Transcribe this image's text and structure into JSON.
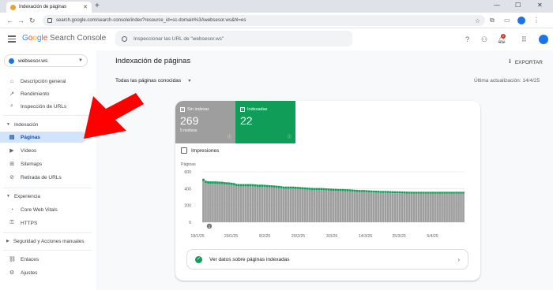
{
  "browser": {
    "tab_title": "Indexación de páginas",
    "new_tab": "+",
    "url": "search.google.com/search-console/index?resource_id=sc-domain%3Awebsesor.ws&hl=es",
    "minimize": "—",
    "maximize": "☐",
    "close": "✕"
  },
  "header": {
    "logo_google": [
      "G",
      "o",
      "o",
      "g",
      "l",
      "e"
    ],
    "logo_product": " Search Console",
    "search_placeholder": "Inspeccionar las URL de \"websesor.ws\"",
    "notification_count": "2"
  },
  "sidebar": {
    "property": "websesor.ws",
    "items": [
      {
        "label": "Descripción general",
        "icon": "home-icon"
      },
      {
        "label": "Rendimiento",
        "icon": "trend-icon"
      },
      {
        "label": "Inspección de URLs",
        "icon": "search-icon"
      },
      {
        "label": "Páginas",
        "icon": "pages-icon"
      },
      {
        "label": "Vídeos",
        "icon": "video-icon"
      },
      {
        "label": "Sitemaps",
        "icon": "sitemap-icon"
      },
      {
        "label": "Retirada de URLs",
        "icon": "removal-icon"
      },
      {
        "label": "Core Web Vitals",
        "icon": "speed-icon"
      },
      {
        "label": "HTTPS",
        "icon": "lock-icon"
      },
      {
        "label": "Enlaces",
        "icon": "links-icon"
      },
      {
        "label": "Ajustes",
        "icon": "gear-icon"
      }
    ],
    "sections": [
      "Indexación",
      "Experiencia",
      "Seguridad y Acciones manuales"
    ]
  },
  "main": {
    "title": "Indexación de páginas",
    "export_label": "EXPORTAR",
    "filter_label": "Todas las páginas conocidas",
    "last_update": "Última actualización: 14/4/25",
    "not_indexed": {
      "label": "Sin indexar",
      "value": "269",
      "sub": "5 motivos"
    },
    "indexed": {
      "label": "Indexadas",
      "value": "22"
    },
    "impressions_label": "Impresiones",
    "indexed_link": "Ver datos sobre páginas indexadas"
  },
  "colors": {
    "not_indexed": "#9e9e9e",
    "indexed": "#0f9d58",
    "active_nav": "#d2e3fc",
    "arrow": "#ff0000"
  },
  "chart_data": {
    "type": "bar",
    "ylabel": "Páginas",
    "ylim": [
      0,
      600
    ],
    "yticks": [
      "600",
      "400",
      "200",
      "0"
    ],
    "xticks": [
      "18/1/25",
      "29/1/25",
      "9/2/25",
      "20/2/25",
      "3/3/25",
      "14/3/25",
      "25/3/25",
      "5/4/25"
    ],
    "annotation": "1",
    "series": [
      {
        "name": "Sin indexar",
        "values": [
          488,
          466,
          460,
          458,
          458,
          458,
          456,
          455,
          455,
          450,
          448,
          447,
          444,
          440,
          430,
          428,
          428,
          428,
          428,
          428,
          428,
          428,
          425,
          422,
          422,
          422,
          420,
          418,
          416,
          414,
          412,
          410,
          408,
          405,
          400,
          400,
          400,
          400,
          400,
          398,
          396,
          394,
          392,
          390,
          388,
          386,
          384,
          384,
          384,
          384,
          384,
          382,
          380,
          378,
          376,
          375,
          374,
          372,
          372,
          372,
          370,
          370,
          368,
          366,
          364,
          362,
          360,
          360,
          360,
          358,
          356,
          355,
          354,
          353,
          352,
          350,
          350,
          350,
          349,
          348,
          347,
          346,
          346,
          345,
          344,
          343,
          342,
          341,
          341,
          340,
          340,
          340,
          340,
          340,
          340,
          340,
          340,
          340,
          340,
          340,
          340,
          340,
          340,
          340,
          340,
          340,
          340,
          340,
          340,
          340,
          340
        ]
      },
      {
        "name": "Indexadas",
        "values": [
          30,
          28,
          28,
          28,
          28,
          28,
          28,
          28,
          27,
          27,
          27,
          27,
          26,
          26,
          26,
          26,
          26,
          26,
          26,
          26,
          26,
          25,
          25,
          25,
          25,
          25,
          25,
          25,
          25,
          25,
          25,
          25,
          25,
          24,
          24,
          24,
          24,
          24,
          24,
          24,
          24,
          24,
          24,
          24,
          24,
          24,
          24,
          23,
          23,
          23,
          23,
          23,
          23,
          23,
          23,
          23,
          23,
          23,
          23,
          23,
          23,
          23,
          23,
          23,
          23,
          23,
          23,
          23,
          23,
          23,
          23,
          22,
          22,
          22,
          22,
          22,
          22,
          22,
          22,
          22,
          22,
          22,
          22,
          22,
          22,
          22,
          22,
          22,
          22,
          22,
          22,
          22,
          22,
          22,
          22,
          22,
          22,
          22,
          22,
          22,
          22,
          22,
          22,
          22,
          22,
          22,
          22,
          22,
          22,
          22,
          22
        ]
      }
    ]
  }
}
